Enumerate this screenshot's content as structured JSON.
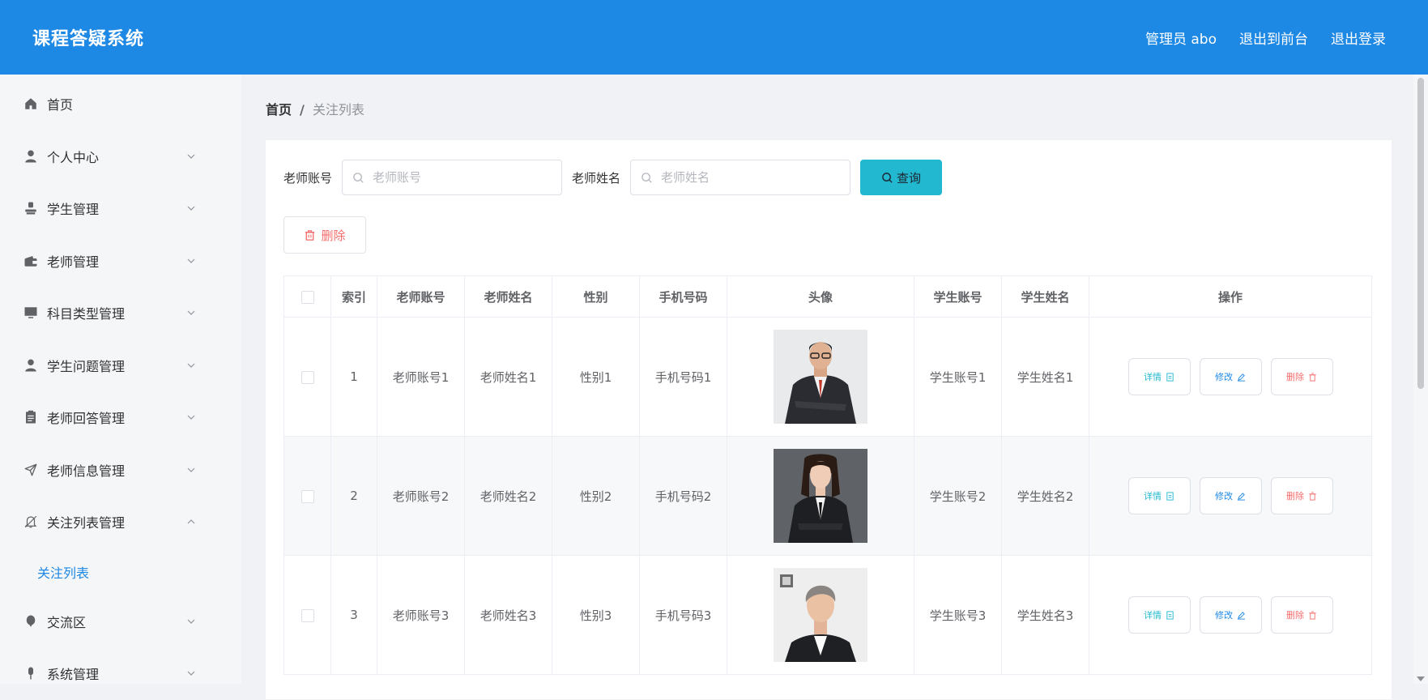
{
  "header": {
    "title": "课程答疑系统",
    "nav": [
      "管理员 abo",
      "退出到前台",
      "退出登录"
    ]
  },
  "sidebar": {
    "items": [
      {
        "label": "首页",
        "icon": "home-icon",
        "expandable": false
      },
      {
        "label": "个人中心",
        "icon": "user-icon",
        "expandable": true
      },
      {
        "label": "学生管理",
        "icon": "student-icon",
        "expandable": true
      },
      {
        "label": "老师管理",
        "icon": "wallet-icon",
        "expandable": true
      },
      {
        "label": "科目类型管理",
        "icon": "monitor-icon",
        "expandable": true
      },
      {
        "label": "学生问题管理",
        "icon": "user-icon",
        "expandable": true
      },
      {
        "label": "老师回答管理",
        "icon": "clipboard-icon",
        "expandable": true
      },
      {
        "label": "老师信息管理",
        "icon": "send-icon",
        "expandable": true
      },
      {
        "label": "关注列表管理",
        "icon": "bell-off-icon",
        "expandable": true,
        "expanded": true
      },
      {
        "label": "交流区",
        "icon": "balloon-icon",
        "expandable": true
      },
      {
        "label": "系统管理",
        "icon": "mic-icon",
        "expandable": true
      }
    ],
    "submenu": {
      "label": "关注列表"
    }
  },
  "breadcrumb": {
    "home": "首页",
    "separator": "/",
    "current": "关注列表"
  },
  "search": {
    "teacher_account_label": "老师账号",
    "teacher_account_placeholder": "老师账号",
    "teacher_name_label": "老师姓名",
    "teacher_name_placeholder": "老师姓名",
    "query_label": "查询"
  },
  "toolbar": {
    "delete_label": "删除"
  },
  "table": {
    "headers": [
      "索引",
      "老师账号",
      "老师姓名",
      "性别",
      "手机号码",
      "头像",
      "学生账号",
      "学生姓名",
      "操作"
    ],
    "rows": [
      {
        "index": "1",
        "teacher_account": "老师账号1",
        "teacher_name": "老师姓名1",
        "gender": "性别1",
        "phone": "手机号码1",
        "student_account": "学生账号1",
        "student_name": "学生姓名1"
      },
      {
        "index": "2",
        "teacher_account": "老师账号2",
        "teacher_name": "老师姓名2",
        "gender": "性别2",
        "phone": "手机号码2",
        "student_account": "学生账号2",
        "student_name": "学生姓名2"
      },
      {
        "index": "3",
        "teacher_account": "老师账号3",
        "teacher_name": "老师姓名3",
        "gender": "性别3",
        "phone": "手机号码3",
        "student_account": "学生账号3",
        "student_name": "学生姓名3"
      }
    ],
    "actions": {
      "detail": "详情",
      "edit": "修改",
      "delete": "删除"
    }
  },
  "colors": {
    "header_bg": "#1e88e5",
    "accent": "#1e88e5",
    "query_btn": "#22b8cf",
    "danger": "#f56c6c"
  }
}
